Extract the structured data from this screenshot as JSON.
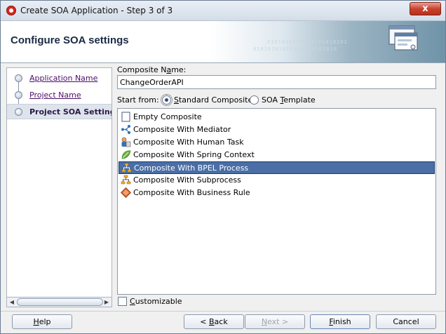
{
  "window": {
    "title": "Create SOA Application - Step 3 of 3",
    "close_label": "x"
  },
  "header": {
    "title": "Configure SOA settings",
    "binary_text": "0101010101010101010101",
    "binary_text_2": "01010101010101010101010"
  },
  "nav": {
    "items": [
      {
        "label": "Application Name",
        "state": "visited"
      },
      {
        "label": "Project Name",
        "state": "visited"
      },
      {
        "label": "Project SOA Settings",
        "state": "current"
      }
    ]
  },
  "form": {
    "composite_name_label_pre": "Composite N",
    "composite_name_label_mnemonic": "a",
    "composite_name_label_post": "me:",
    "composite_name_value": "ChangeOrderAPI",
    "start_from_label": "Start from:",
    "radio_standard_pre": "",
    "radio_standard_mnemonic": "S",
    "radio_standard_post": "tandard Composite",
    "radio_template_pre": "SOA ",
    "radio_template_mnemonic": "T",
    "radio_template_post": "emplate",
    "selected_start": "Standard Composite",
    "customizable_pre": "",
    "customizable_mnemonic": "C",
    "customizable_post": "ustomizable",
    "customizable_checked": false
  },
  "templates": [
    {
      "label": "Empty Composite",
      "icon": "empty-composite-icon",
      "selected": false
    },
    {
      "label": "Composite With Mediator",
      "icon": "mediator-icon",
      "selected": false
    },
    {
      "label": "Composite With Human Task",
      "icon": "human-task-icon",
      "selected": false
    },
    {
      "label": "Composite With Spring Context",
      "icon": "spring-context-icon",
      "selected": false
    },
    {
      "label": "Composite With BPEL Process",
      "icon": "bpel-process-icon",
      "selected": true
    },
    {
      "label": "Composite With Subprocess",
      "icon": "subprocess-icon",
      "selected": false
    },
    {
      "label": "Composite With Business Rule",
      "icon": "business-rule-icon",
      "selected": false
    }
  ],
  "buttons": {
    "help_pre": "",
    "help_mnemonic": "H",
    "help_post": "elp",
    "back_pre": "< ",
    "back_mnemonic": "B",
    "back_post": "ack",
    "next_pre": "",
    "next_mnemonic": "N",
    "next_post": "ext >",
    "finish_pre": "",
    "finish_mnemonic": "F",
    "finish_post": "inish",
    "cancel_label": "Cancel",
    "next_enabled": false
  },
  "colors": {
    "selection": "#4a6ea5",
    "nav_link": "#4b0e6b",
    "header_title": "#1a2b44"
  }
}
